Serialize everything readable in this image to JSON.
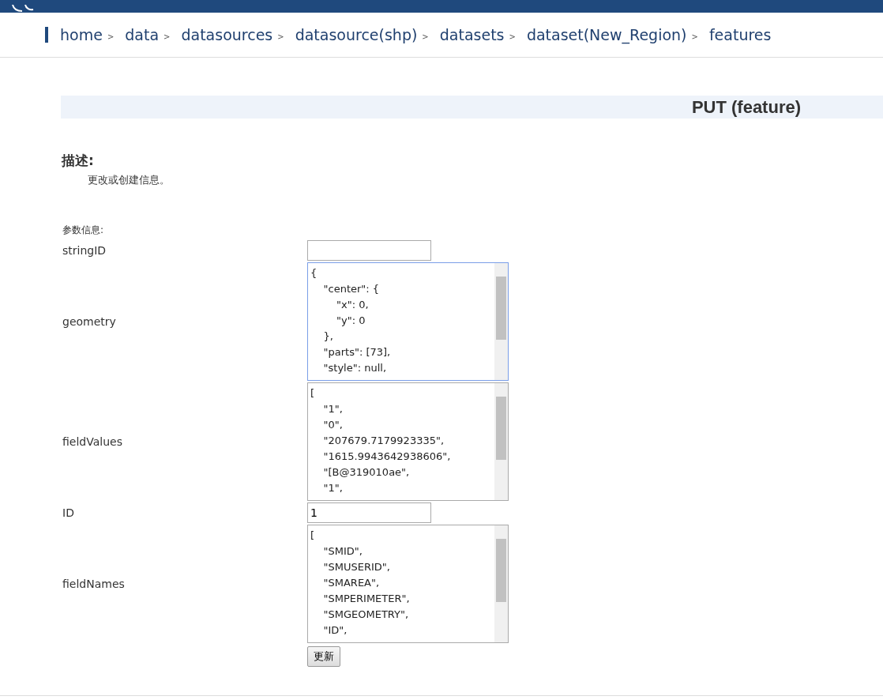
{
  "breadcrumb": [
    {
      "label": "home",
      "separator": ">"
    },
    {
      "label": "data",
      "separator": ">"
    },
    {
      "label": "datasources",
      "separator": ">"
    },
    {
      "label": "datasource(shp)",
      "separator": ">"
    },
    {
      "label": "datasets",
      "separator": ">"
    },
    {
      "label": "dataset(New_Region)",
      "separator": ">"
    },
    {
      "label": "features"
    }
  ],
  "title": "PUT (feature)",
  "description": {
    "heading": "描述:",
    "text": "更改或创建信息。"
  },
  "params_heading": "参数信息:",
  "params": [
    {
      "label": "stringID",
      "kind": "input"
    },
    {
      "label": "geometry",
      "kind": "textarea",
      "focused": true,
      "lines": [
        "{",
        "    \"center\": {",
        "        \"x\": 0,",
        "        \"y\": 0",
        "    },",
        "    \"parts\": [73],",
        "    \"style\": null,"
      ]
    },
    {
      "label": "fieldValues",
      "kind": "textarea",
      "focused": false,
      "lines": [
        "[",
        "    \"1\",",
        "    \"0\",",
        "    \"207679.7179923335\",",
        "    \"1615.9943642938606\",",
        "    \"[B@319010ae\",",
        "    \"1\","
      ]
    },
    {
      "label": "ID",
      "kind": "input",
      "value": "1"
    },
    {
      "label": "fieldNames",
      "kind": "textarea",
      "focused": false,
      "lines": [
        "[",
        "    \"SMID\",",
        "    \"SMUSERID\",",
        "    \"SMAREA\",",
        "    \"SMPERIMETER\",",
        "    \"SMGEOMETRY\",",
        "    \"ID\","
      ]
    }
  ],
  "submit": "更新"
}
